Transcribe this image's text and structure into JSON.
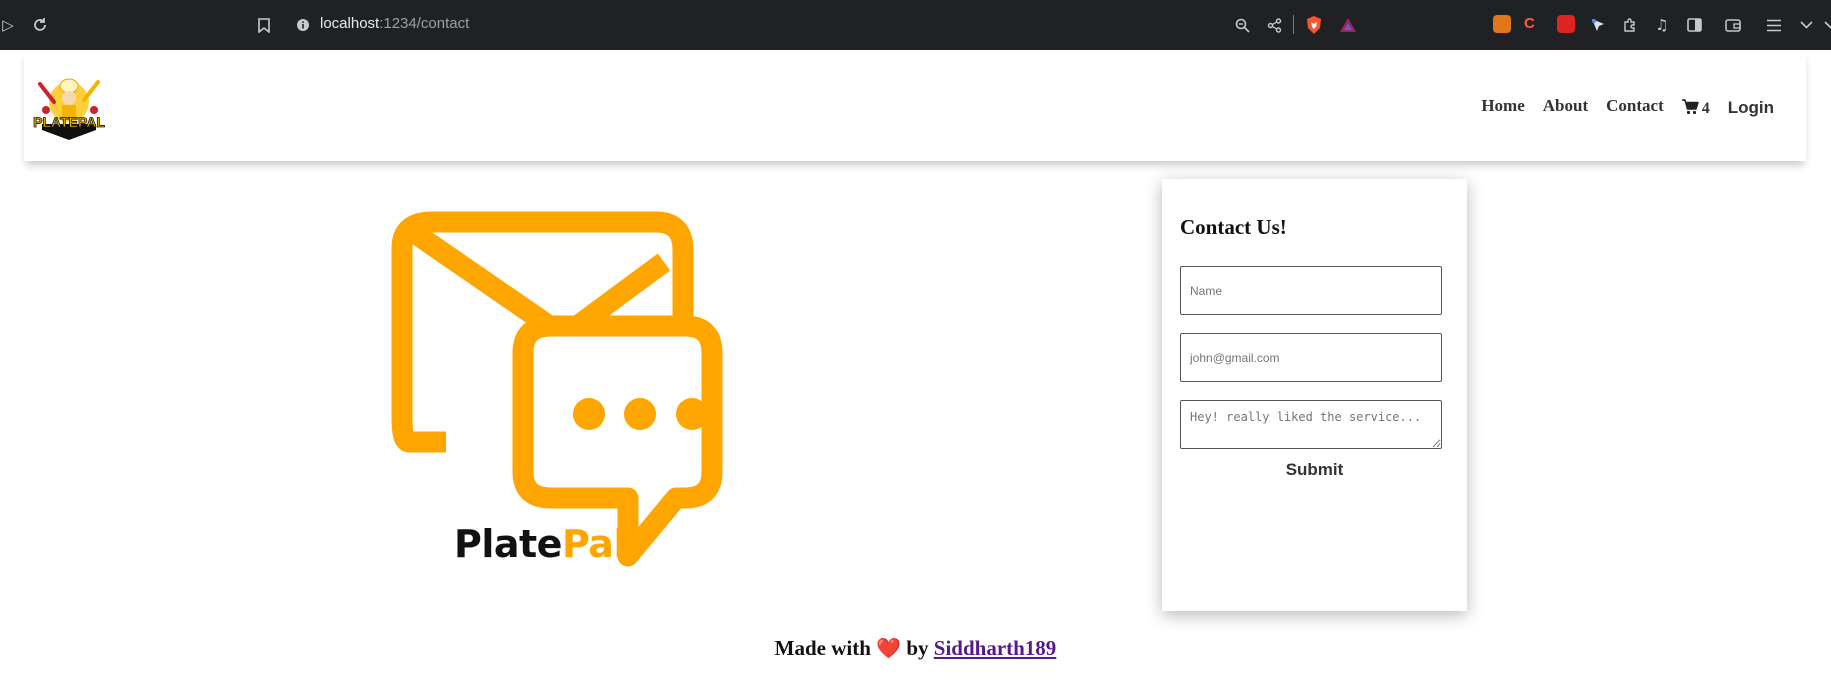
{
  "browser": {
    "url_host": "localhost",
    "url_path": ":1234/contact"
  },
  "header": {
    "logo_text": "PLATEPAL",
    "nav": [
      {
        "label": "Home"
      },
      {
        "label": "About"
      },
      {
        "label": "Contact"
      }
    ],
    "cart_count": "4",
    "login_label": "Login"
  },
  "hero": {
    "brand_part1": "Plate",
    "brand_part2": "Pal",
    "accent_color": "#FFA500"
  },
  "contact": {
    "title": "Contact Us!",
    "name_placeholder": "Name",
    "email_placeholder": "john@gmail.com",
    "message_placeholder": "Hey! really liked the service...",
    "submit_label": "Submit"
  },
  "footer": {
    "prefix": "Made with",
    "heart": "❤️",
    "by": "by",
    "author": "Siddharth189"
  }
}
